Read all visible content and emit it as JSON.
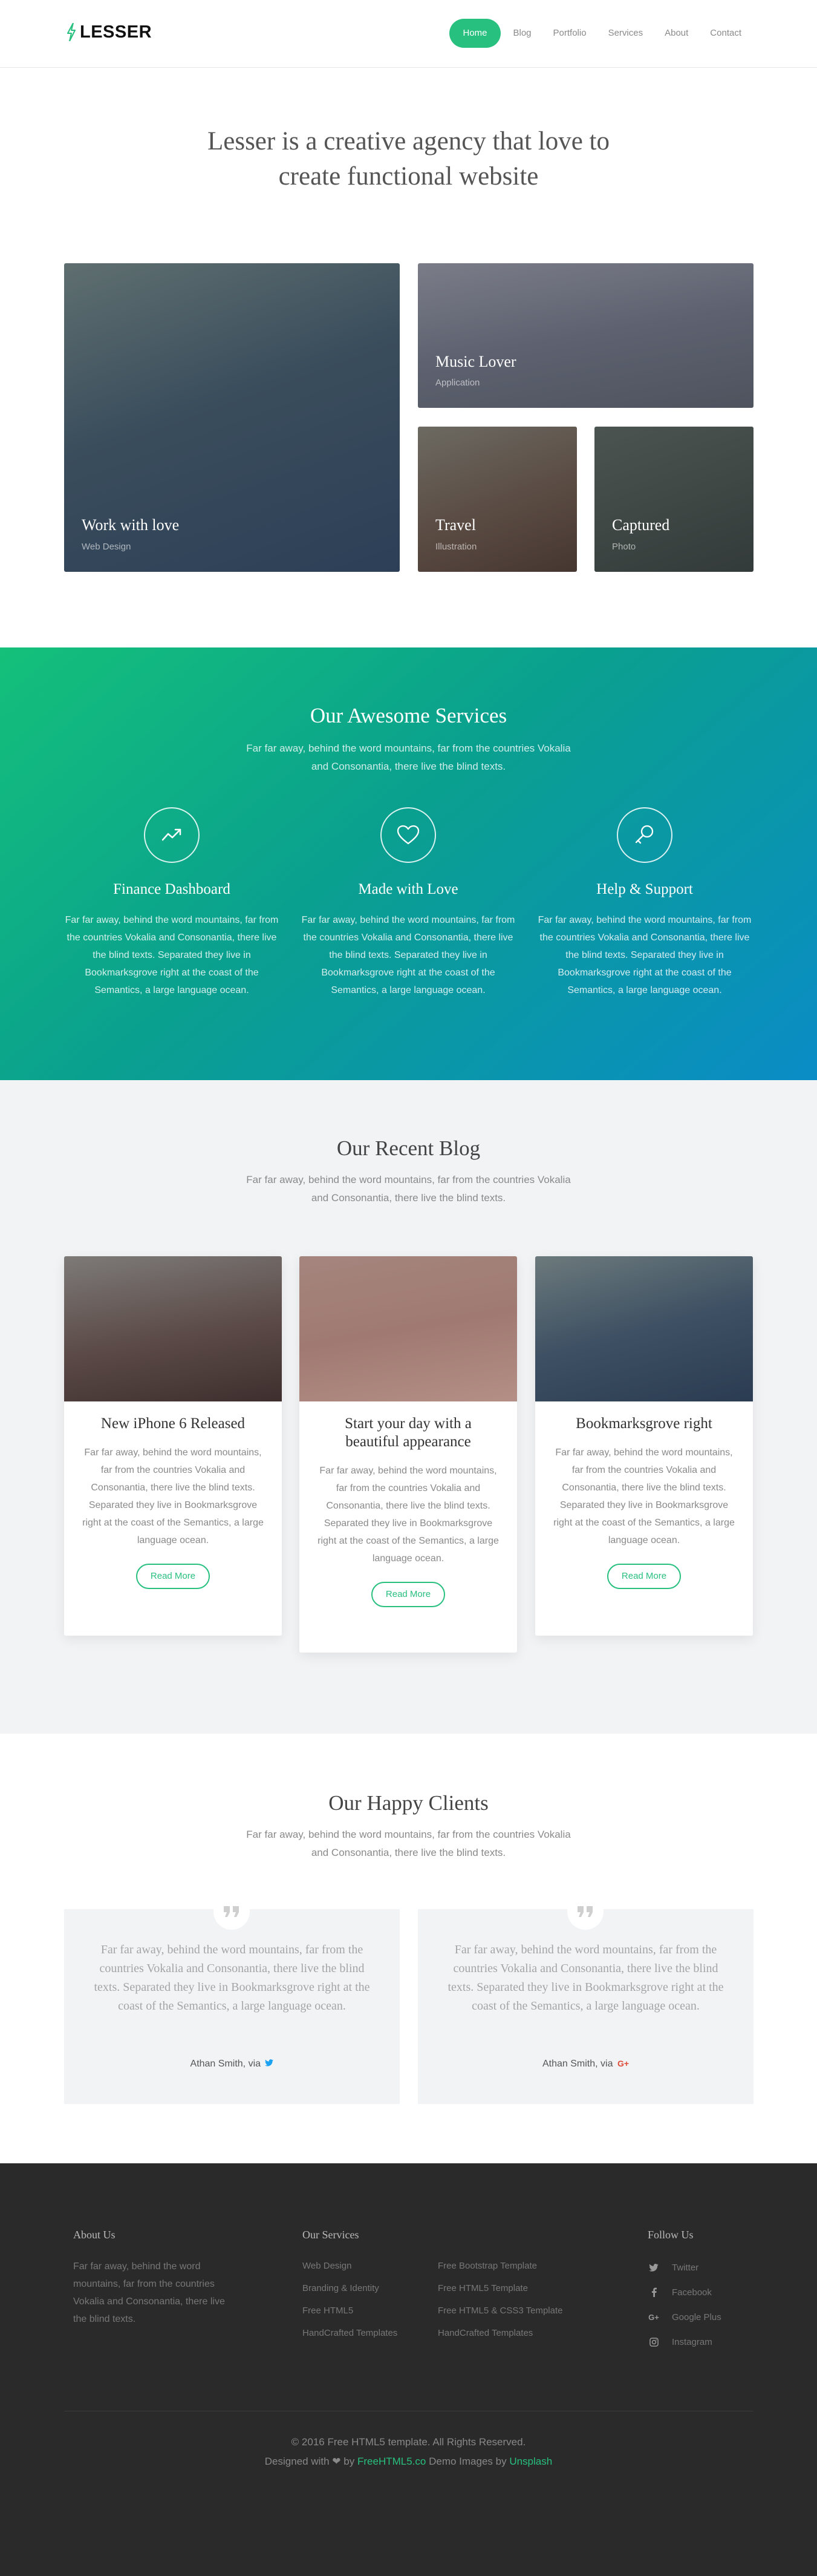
{
  "nav": {
    "logo": "LESSER",
    "items": [
      {
        "label": "Home"
      },
      {
        "label": "Blog"
      },
      {
        "label": "Portfolio"
      },
      {
        "label": "Services"
      },
      {
        "label": "About"
      },
      {
        "label": "Contact"
      }
    ],
    "active_color": "#28c07f"
  },
  "hero": {
    "line1": "Lesser is a creative agency that love to",
    "line2": "create functional website"
  },
  "works": [
    {
      "title": "Work with love",
      "category": "Web Design"
    },
    {
      "title": "Music Lover",
      "category": "Application"
    },
    {
      "title": "Travel",
      "category": "Illustration"
    },
    {
      "title": "Captured",
      "category": "Photo"
    }
  ],
  "services": {
    "title": "Our Awesome Services",
    "intro": "Far far away, behind the word mountains, far from the countries Vokalia and Consonantia, there live the blind texts.",
    "items": [
      {
        "icon": "trend-chart-icon",
        "title": "Finance Dashboard",
        "text": "Far far away, behind the word mountains, far from the countries Vokalia and Consonantia, there live the blind texts. Separated they live in Bookmarksgrove right at the coast of the Semantics, a large language ocean."
      },
      {
        "icon": "heart-icon",
        "title": "Made with Love",
        "text": "Far far away, behind the word mountains, far from the countries Vokalia and Consonantia, there live the blind texts. Separated they live in Bookmarksgrove right at the coast of the Semantics, a large language ocean."
      },
      {
        "icon": "key-icon",
        "title": "Help & Support",
        "text": "Far far away, behind the word mountains, far from the countries Vokalia and Consonantia, there live the blind texts. Separated they live in Bookmarksgrove right at the coast of the Semantics, a large language ocean."
      }
    ]
  },
  "blog": {
    "title": "Our Recent Blog",
    "intro": "Far far away, behind the word mountains, far from the countries Vokalia and Consonantia, there live the blind texts.",
    "posts": [
      {
        "title": "New iPhone 6 Released",
        "text": "Far far away, behind the word mountains, far from the countries Vokalia and Consonantia, there live the blind texts. Separated they live in Bookmarksgrove right at the coast of the Semantics, a large language ocean.",
        "button": "Read More"
      },
      {
        "title": "Start your day with a beautiful appearance",
        "text": "Far far away, behind the word mountains, far from the countries Vokalia and Consonantia, there live the blind texts. Separated they live in Bookmarksgrove right at the coast of the Semantics, a large language ocean.",
        "button": "Read More"
      },
      {
        "title": "Bookmarksgrove right",
        "text": "Far far away, behind the word mountains, far from the countries Vokalia and Consonantia, there live the blind texts. Separated they live in Bookmarksgrove right at the coast of the Semantics, a large language ocean.",
        "button": "Read More"
      }
    ]
  },
  "clients": {
    "title": "Our Happy Clients",
    "intro": "Far far away, behind the word mountains, far from the countries Vokalia and Consonantia, there live the blind texts.",
    "testimonials": [
      {
        "quote": "Far far away, behind the word mountains, far from the countries Vokalia and Consonantia, there live the blind texts. Separated they live in Bookmarksgrove right at the coast of the Semantics, a large language ocean.",
        "author": "Athan Smith, via",
        "network_icon": "twitter-icon"
      },
      {
        "quote": "Far far away, behind the word mountains, far from the countries Vokalia and Consonantia, there live the blind texts. Separated they live in Bookmarksgrove right at the coast of the Semantics, a large language ocean.",
        "author": "Athan Smith, via",
        "network_icon": "google-plus-icon"
      }
    ]
  },
  "footer": {
    "about_title": "About Us",
    "about_text": "Far far away, behind the word mountains, far from the countries Vokalia and Consonantia, there live the blind texts.",
    "services_title": "Our Services",
    "services_col1": [
      "Web Design",
      "Branding & Identity",
      "Free HTML5",
      "HandCrafted Templates"
    ],
    "services_col2": [
      "Free Bootstrap Template",
      "Free HTML5 Template",
      "Free HTML5 & CSS3 Template",
      "HandCrafted Templates"
    ],
    "follow_title": "Follow Us",
    "social": [
      {
        "icon": "twitter-icon",
        "label": "Twitter"
      },
      {
        "icon": "facebook-icon",
        "label": "Facebook"
      },
      {
        "icon": "google-plus-icon",
        "label": "Google Plus"
      },
      {
        "icon": "instagram-icon",
        "label": "Instagram"
      }
    ],
    "copyright": "© 2016 Free HTML5 template. All Rights Reserved.",
    "designed_prefix": "Designed with",
    "designed_by": "by",
    "designer": "FreeHTML5.co",
    "demo_images": "Demo Images by",
    "image_source": "Unsplash"
  }
}
